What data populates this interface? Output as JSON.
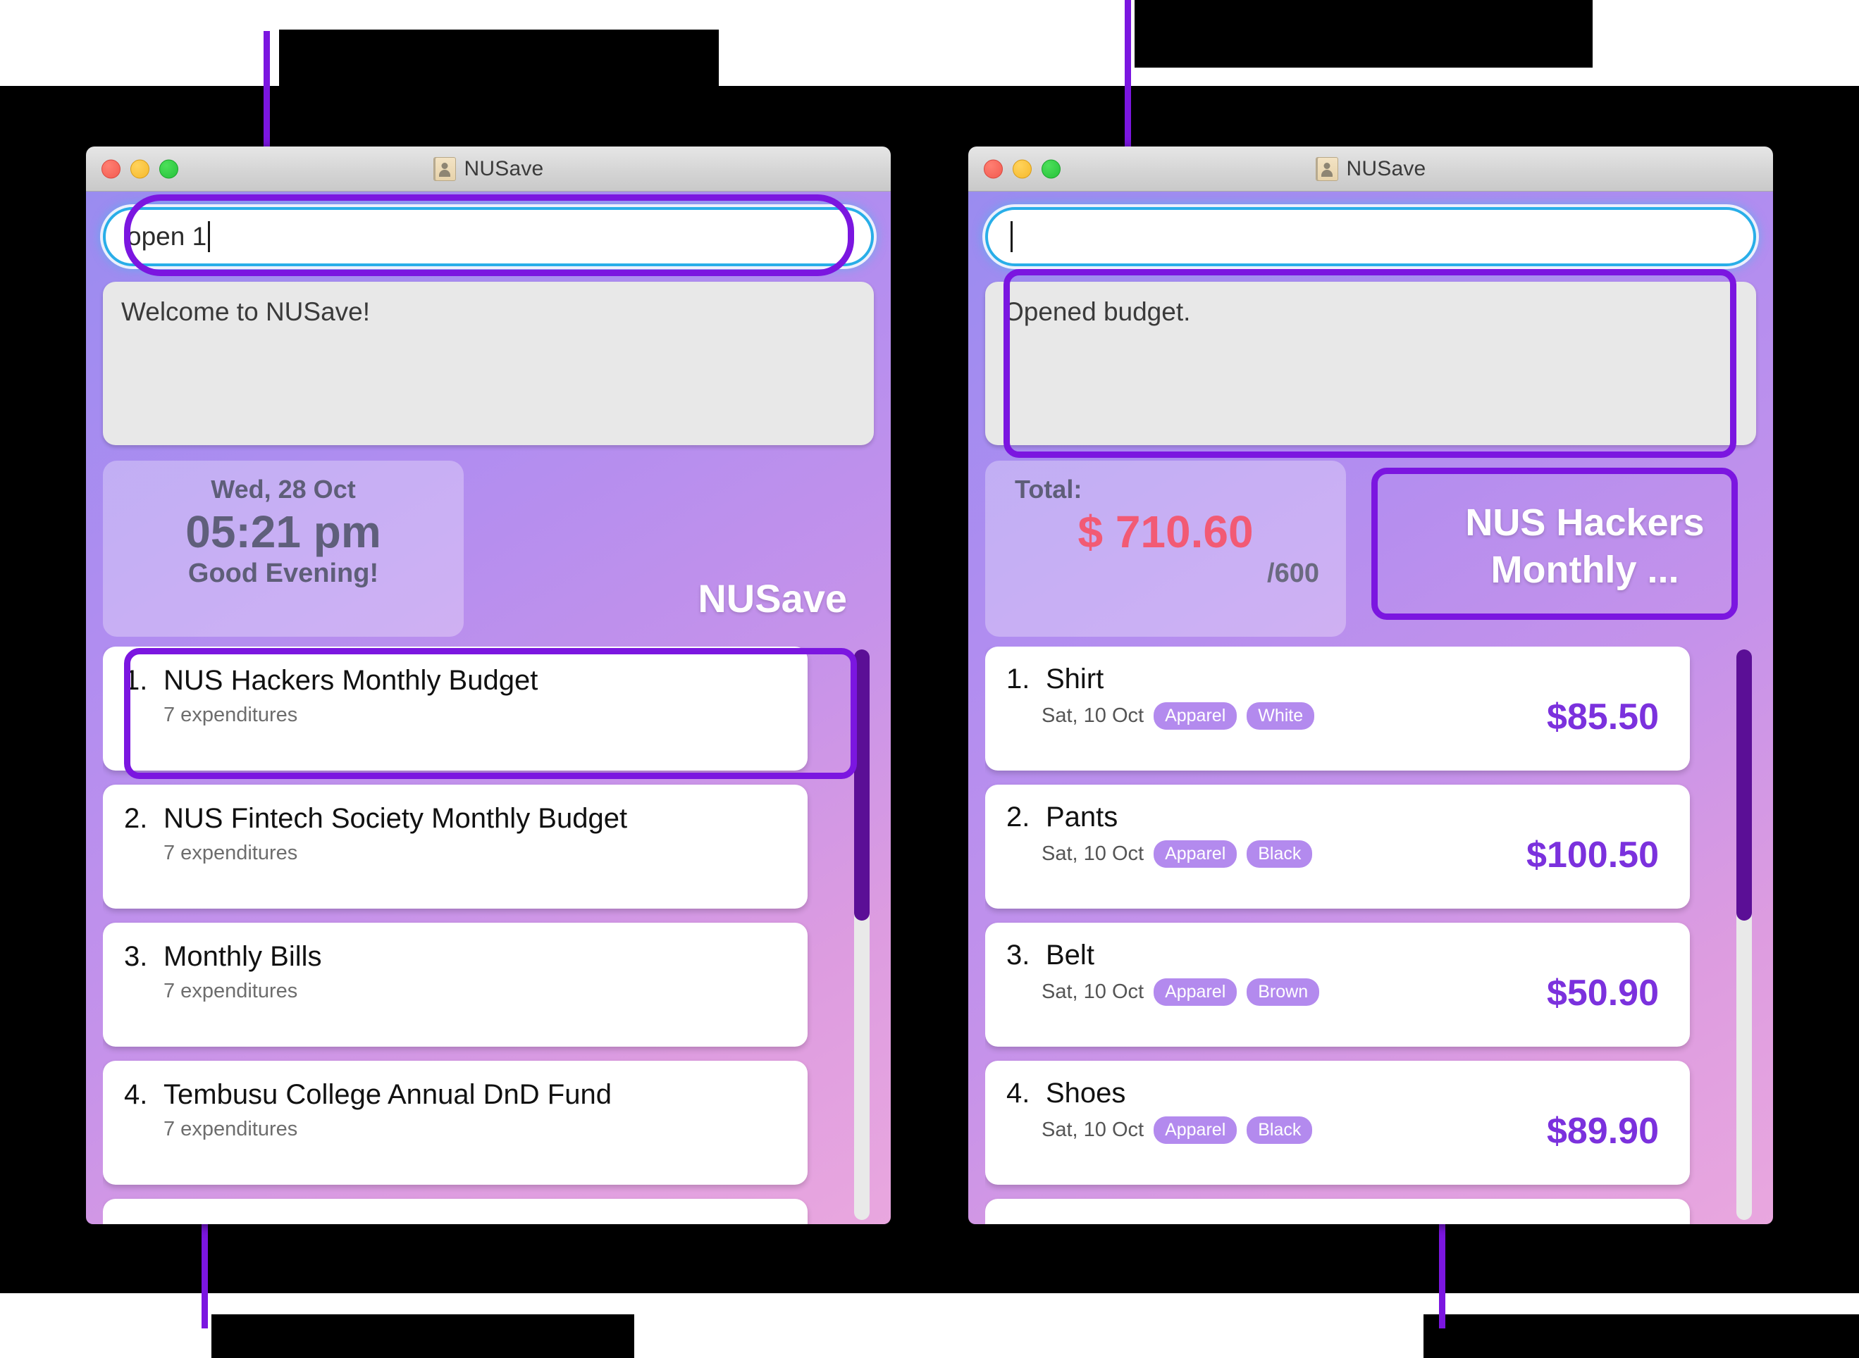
{
  "app": {
    "name": "NUSave",
    "icon": "contact-card-icon"
  },
  "colors": {
    "accent_purple": "#7b16e0",
    "amount_purple": "#7b31dd",
    "total_red": "#f25a74",
    "focus_blue": "#29aee8",
    "tag_purple": "#b38aee",
    "scroll_thumb": "#5b0f96"
  },
  "windows": [
    {
      "id": "left",
      "title": "NUSave",
      "traffic_lights": [
        "close",
        "minimize",
        "zoom"
      ],
      "command": {
        "value": "open 1",
        "placeholder": "",
        "has_caret": true
      },
      "feedback": {
        "message": "Welcome to NUSave!"
      },
      "info_card": {
        "date": "Wed, 28 Oct",
        "time": "05:21 pm",
        "greeting": "Good Evening!"
      },
      "brand": "NUSave",
      "list": [
        {
          "index": "1.",
          "title": "NUS Hackers Monthly Budget",
          "sub": "7 expenditures"
        },
        {
          "index": "2.",
          "title": "NUS Fintech Society Monthly Budget",
          "sub": "7 expenditures"
        },
        {
          "index": "3.",
          "title": "Monthly Bills",
          "sub": "7 expenditures"
        },
        {
          "index": "4.",
          "title": "Tembusu College Annual DnD Fund",
          "sub": "7 expenditures"
        }
      ]
    },
    {
      "id": "right",
      "title": "NUSave",
      "traffic_lights": [
        "close",
        "minimize",
        "zoom"
      ],
      "command": {
        "value": "",
        "placeholder": "",
        "has_caret": true
      },
      "feedback": {
        "message": "Opened budget."
      },
      "info_card": {
        "label": "Total:",
        "amount": "$ 710.60",
        "threshold": "/600"
      },
      "budget_chip": {
        "line1": "NUS Hackers",
        "line2": "Monthly ..."
      },
      "list": [
        {
          "index": "1.",
          "title": "Shirt",
          "date": "Sat, 10 Oct",
          "tags": [
            "Apparel",
            "White"
          ],
          "amount": "$85.50"
        },
        {
          "index": "2.",
          "title": "Pants",
          "date": "Sat, 10 Oct",
          "tags": [
            "Apparel",
            "Black"
          ],
          "amount": "$100.50"
        },
        {
          "index": "3.",
          "title": "Belt",
          "date": "Sat, 10 Oct",
          "tags": [
            "Apparel",
            "Brown"
          ],
          "amount": "$50.90"
        },
        {
          "index": "4.",
          "title": "Shoes",
          "date": "Sat, 10 Oct",
          "tags": [
            "Apparel",
            "Black"
          ],
          "amount": "$89.90"
        }
      ]
    }
  ],
  "annotations": {
    "redacted": true,
    "callouts": [
      {
        "id": "left-top",
        "text": ""
      },
      {
        "id": "right-top",
        "text": ""
      },
      {
        "id": "left-bottom",
        "text": ""
      },
      {
        "id": "right-bottom",
        "text": ""
      }
    ]
  }
}
